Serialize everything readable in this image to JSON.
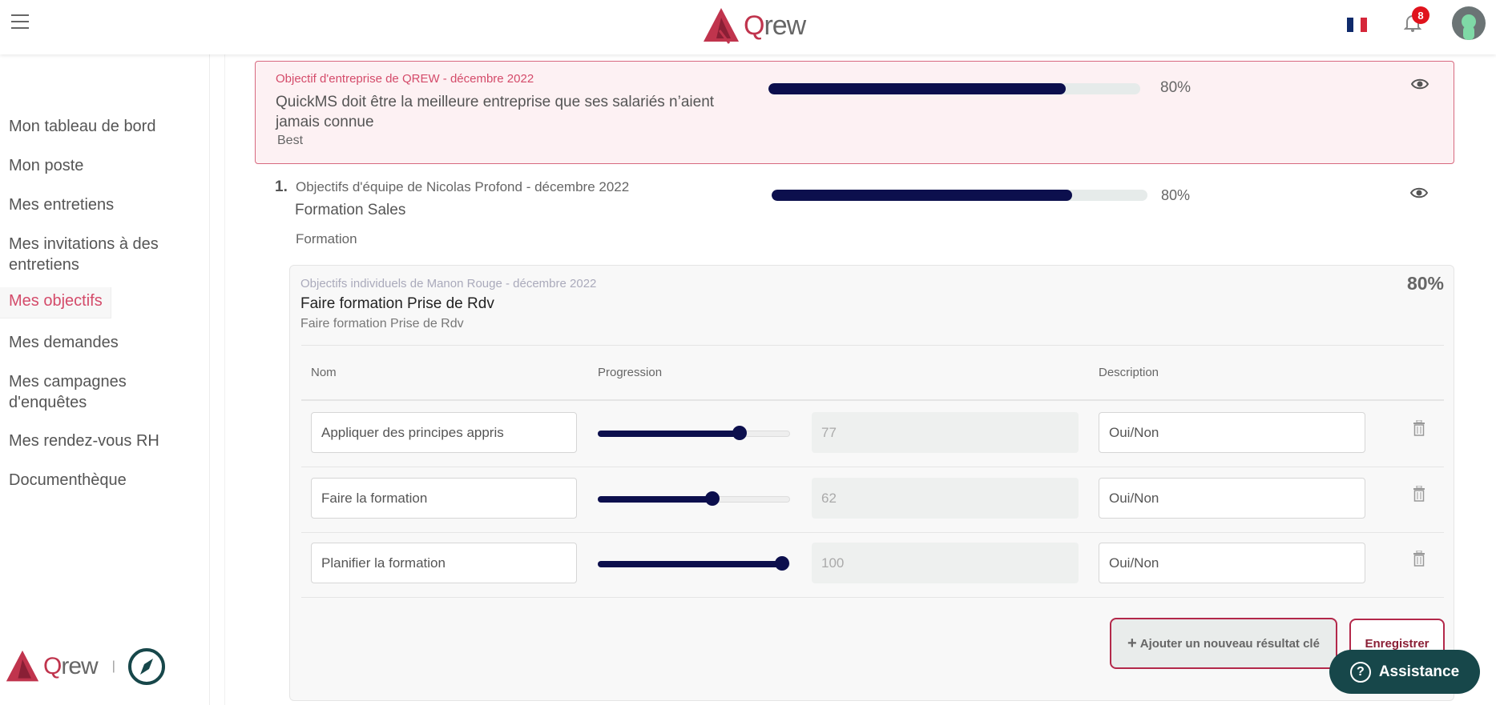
{
  "header": {
    "brand": "Qrew",
    "brand_q": "Q",
    "brand_rest": "rew",
    "notification_count": "8",
    "language": "fr",
    "icons": {
      "menu": "hamburger-icon",
      "notifications": "bell-icon",
      "avatar": "user-avatar"
    }
  },
  "sidebar": {
    "items": [
      {
        "label": "Mon tableau de bord"
      },
      {
        "label": "Mon poste"
      },
      {
        "label": "Mes entretiens"
      },
      {
        "label": "Mes invitations à des entretiens"
      },
      {
        "label": "Mes objectifs",
        "active": true
      },
      {
        "label": "Mes demandes"
      },
      {
        "label": "Mes campagnes d'enquêtes"
      },
      {
        "label": "Mes rendez-vous RH"
      },
      {
        "label": "Documenthèque"
      }
    ],
    "footer_brand_q": "Q",
    "footer_brand_rest": "rew",
    "footer_separator": "|"
  },
  "company_objective": {
    "meta": "Objectif d'entreprise de QREW - décembre 2022",
    "title": "QuickMS doit être la meilleure entreprise que ses salariés n’aient jamais connue",
    "description": "Best",
    "progress": 80,
    "progress_label": "80%"
  },
  "team_objective": {
    "index": "1.",
    "meta": "Objectifs d'équipe de Nicolas Profond - décembre 2022",
    "title": "Formation Sales",
    "description": "Formation",
    "progress": 80,
    "progress_label": "80%"
  },
  "individual_objective": {
    "meta": "Objectifs individuels de Manon Rouge - décembre 2022",
    "title": "Faire formation Prise de Rdv",
    "description": "Faire formation Prise de Rdv",
    "progress_label": "80%",
    "columns": {
      "name": "Nom",
      "progress": "Progression",
      "description": "Description"
    },
    "key_results": [
      {
        "name": "Appliquer des principes appris",
        "value": 77,
        "value_label": "77",
        "description": "Oui/Non"
      },
      {
        "name": "Faire la formation",
        "value": 62,
        "value_label": "62",
        "description": "Oui/Non"
      },
      {
        "name": "Planifier la formation",
        "value": 100,
        "value_label": "100",
        "description": "Oui/Non"
      }
    ],
    "add_button": "Ajouter un nouveau résultat clé",
    "add_icon": "+",
    "save_button": "Enregistrer"
  },
  "assistance": {
    "label": "Assistance",
    "icon": "?"
  },
  "colors": {
    "accent": "#d44b6a",
    "progress": "#0c0f4d",
    "assistance": "#17474a",
    "button_border": "#b3284a"
  }
}
